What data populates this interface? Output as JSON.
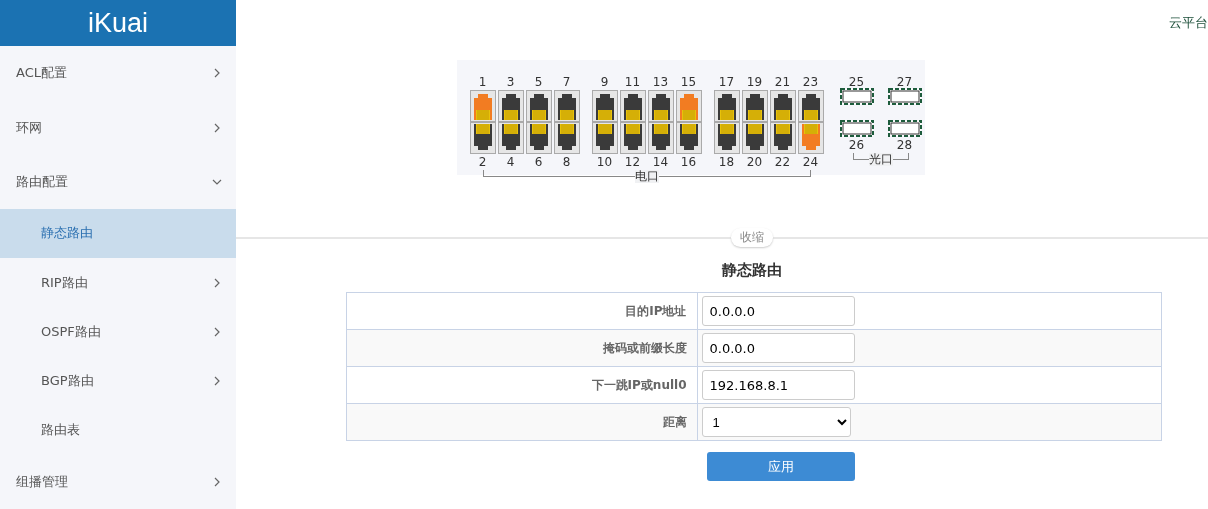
{
  "logo": "iKuai",
  "sidebar": {
    "items": [
      {
        "label": "ACL配置",
        "selected": false,
        "expanded": false
      },
      {
        "label": "环网",
        "selected": false,
        "expanded": false
      },
      {
        "label": "路由配置",
        "selected": false,
        "expanded": true,
        "children": [
          {
            "label": "静态路由",
            "selected": true
          },
          {
            "label": "RIP路由",
            "selected": false,
            "expanded": false
          },
          {
            "label": "OSPF路由",
            "selected": false,
            "expanded": false
          },
          {
            "label": "BGP路由",
            "selected": false,
            "expanded": false
          },
          {
            "label": "路由表",
            "selected": false
          }
        ]
      },
      {
        "label": "组播管理",
        "selected": false,
        "expanded": false
      }
    ]
  },
  "top_link": "云平台",
  "port_panel": {
    "electrical": {
      "label": "电口",
      "groups": [
        {
          "columns": [
            {
              "top": {
                "number": "1",
                "active": true
              },
              "bottom": {
                "number": "2",
                "active": false
              }
            },
            {
              "top": {
                "number": "3",
                "active": false
              },
              "bottom": {
                "number": "4",
                "active": false
              }
            },
            {
              "top": {
                "number": "5",
                "active": false
              },
              "bottom": {
                "number": "6",
                "active": false
              }
            },
            {
              "top": {
                "number": "7",
                "active": false
              },
              "bottom": {
                "number": "8",
                "active": false
              }
            }
          ]
        },
        {
          "columns": [
            {
              "top": {
                "number": "9",
                "active": false
              },
              "bottom": {
                "number": "10",
                "active": false
              }
            },
            {
              "top": {
                "number": "11",
                "active": false
              },
              "bottom": {
                "number": "12",
                "active": false
              }
            },
            {
              "top": {
                "number": "13",
                "active": false
              },
              "bottom": {
                "number": "14",
                "active": false
              }
            },
            {
              "top": {
                "number": "15",
                "active": true
              },
              "bottom": {
                "number": "16",
                "active": false
              }
            }
          ]
        },
        {
          "columns": [
            {
              "top": {
                "number": "17",
                "active": false
              },
              "bottom": {
                "number": "18",
                "active": false
              }
            },
            {
              "top": {
                "number": "19",
                "active": false
              },
              "bottom": {
                "number": "20",
                "active": false
              }
            },
            {
              "top": {
                "number": "21",
                "active": false
              },
              "bottom": {
                "number": "22",
                "active": false
              }
            },
            {
              "top": {
                "number": "23",
                "active": false
              },
              "bottom": {
                "number": "24",
                "active": true
              }
            }
          ]
        }
      ]
    },
    "optical": {
      "label": "光口",
      "columns": [
        {
          "top": {
            "number": "25"
          },
          "bottom": {
            "number": "26"
          }
        },
        {
          "top": {
            "number": "27"
          },
          "bottom": {
            "number": "28"
          }
        }
      ]
    }
  },
  "collapse_label": "收缩",
  "form": {
    "title": "静态路由",
    "rows": [
      {
        "label": "目的IP地址",
        "kind": "text",
        "value": "0.0.0.0"
      },
      {
        "label": "掩码或前缀长度",
        "kind": "text",
        "value": "0.0.0.0"
      },
      {
        "label": "下一跳IP或null0",
        "kind": "text",
        "value": "192.168.8.1"
      },
      {
        "label": "距离",
        "kind": "select",
        "value": "1"
      }
    ],
    "button": "应用"
  }
}
